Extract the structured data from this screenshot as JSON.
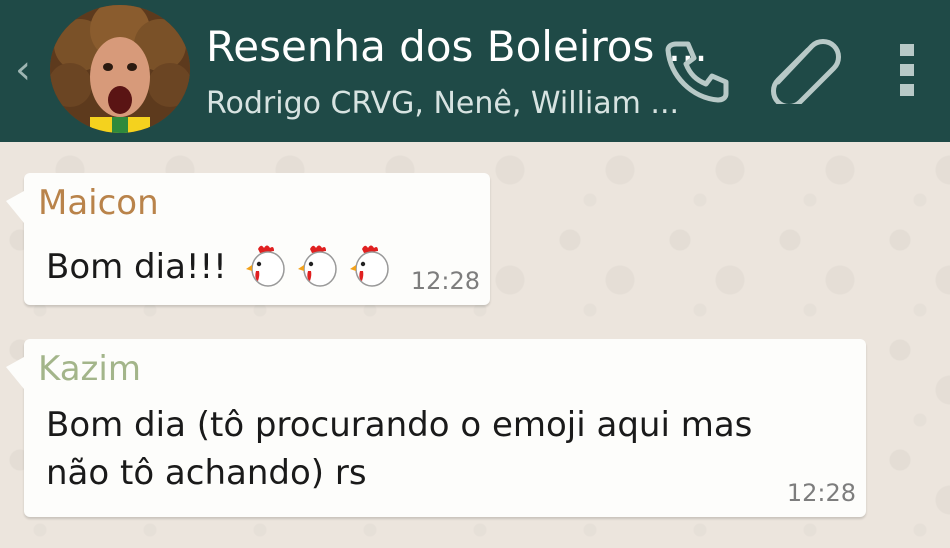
{
  "header": {
    "title": "Resenha dos Boleiros ...",
    "members": "Rodrigo CRVG, Nenê, William ...",
    "bg_color": "#1F4A47"
  },
  "icons": {
    "back": "back-chevron-icon",
    "call": "phone-icon",
    "attach": "paperclip-icon",
    "menu": "overflow-menu-icon"
  },
  "messages": [
    {
      "sender": "Maicon",
      "text": "Bom dia!!!",
      "emoji": "chicken",
      "emoji_count": 3,
      "time": "12:28",
      "sender_color": "#B9834A"
    },
    {
      "sender": "Kazim",
      "text": "Bom dia (tô procurando o emoji aqui mas não tô achando) rs",
      "time": "12:28",
      "sender_color": "#A3B58A"
    }
  ]
}
